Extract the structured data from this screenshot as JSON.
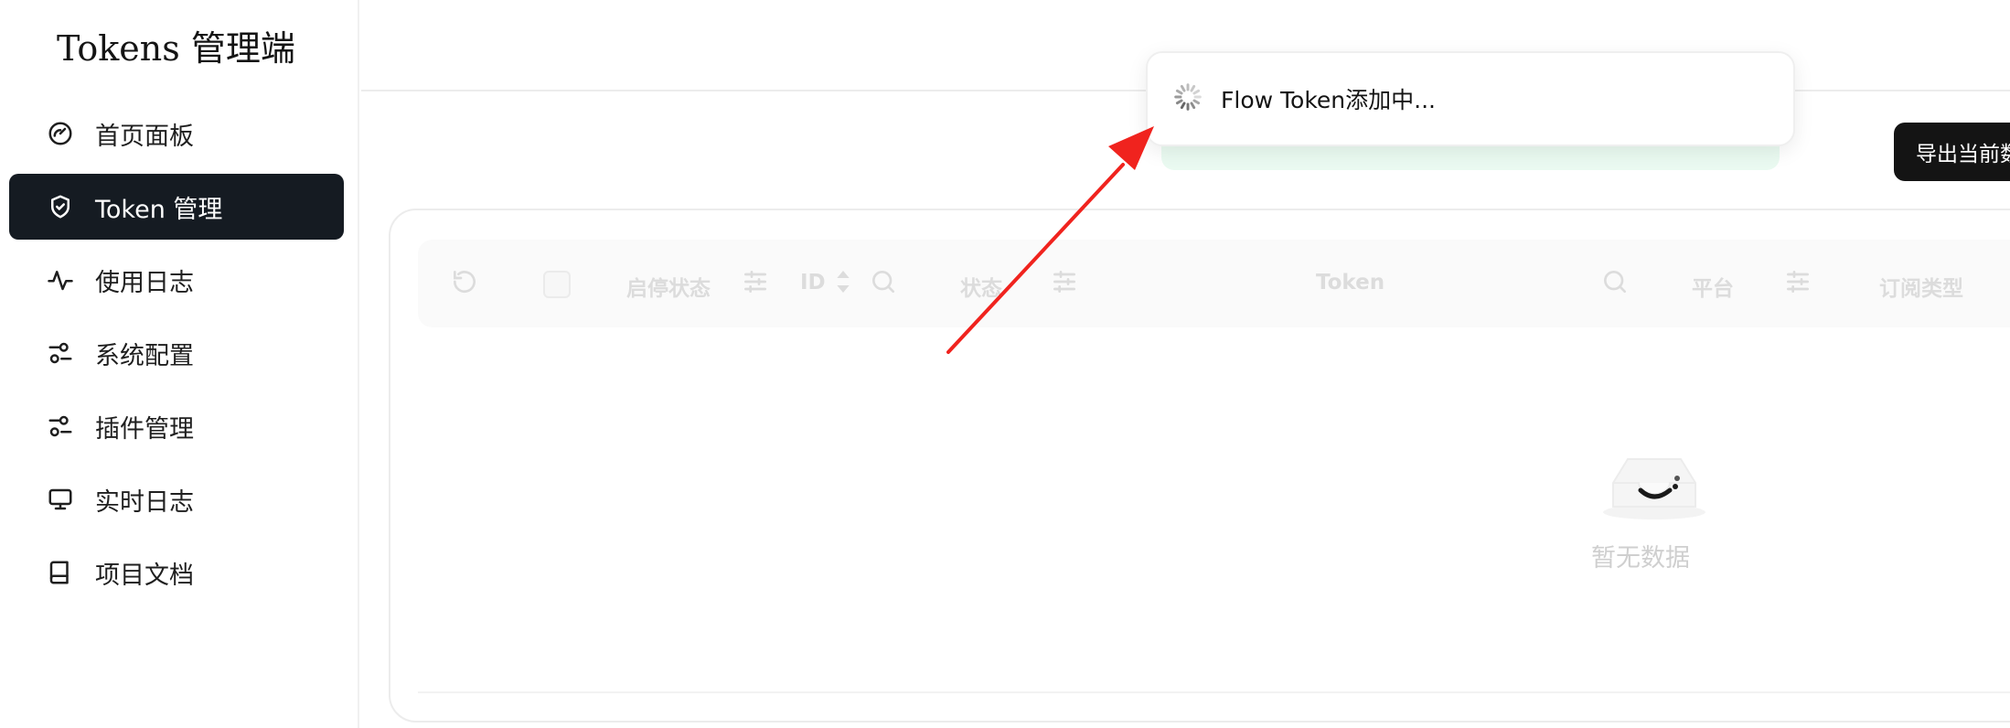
{
  "sidebar": {
    "brand": "Tokens 管理端",
    "items": [
      {
        "label": "首页面板",
        "icon": "gauge-icon"
      },
      {
        "label": "Token 管理",
        "icon": "shield-check-icon",
        "active": true
      },
      {
        "label": "使用日志",
        "icon": "activity-icon"
      },
      {
        "label": "系统配置",
        "icon": "sliders-icon"
      },
      {
        "label": "插件管理",
        "icon": "sliders-icon"
      },
      {
        "label": "实时日志",
        "icon": "monitor-icon"
      },
      {
        "label": "项目文档",
        "icon": "book-icon"
      }
    ]
  },
  "toolbar": {
    "export_label": "导出当前数"
  },
  "toast": {
    "message": "Flow Token添加中..."
  },
  "table": {
    "columns": {
      "status_toggle": "启停状态",
      "id": "ID",
      "status": "状态",
      "token": "Token",
      "platform": "平台",
      "subscription": "订阅类型"
    },
    "empty_text": "暂无数据"
  },
  "colors": {
    "active_nav_bg": "#151b22",
    "toast_bg": "#ffffff",
    "arrow": "#f0231e",
    "muted_text": "#dcdcdc"
  }
}
